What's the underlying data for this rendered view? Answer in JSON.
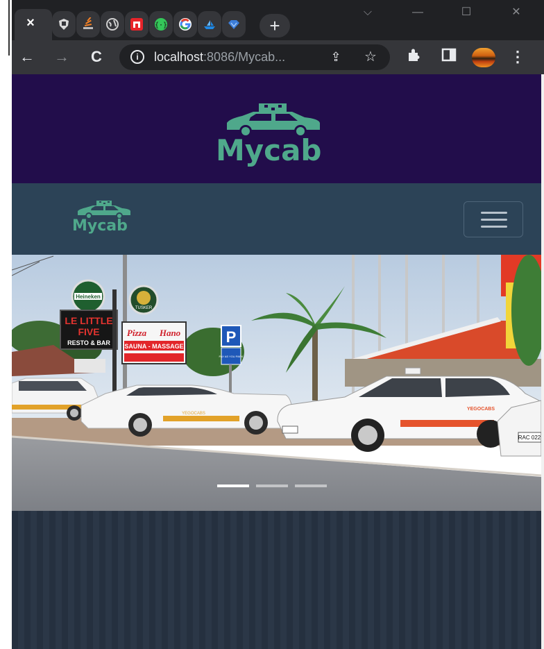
{
  "browser": {
    "active_tab_close": "×",
    "pinned_tabs": [
      {
        "icon": "shield-icon",
        "color": "#d9d9d9"
      },
      {
        "icon": "stack-icon",
        "color": "#f48024"
      },
      {
        "icon": "globe-icon",
        "color": "#cfcfcf"
      },
      {
        "icon": "n-logo-icon",
        "color": "#e8242a"
      },
      {
        "icon": "brackets-icon",
        "color": "#34c759"
      },
      {
        "icon": "google-icon",
        "color": "#4285f4"
      },
      {
        "icon": "boat-icon",
        "color": "#1e88e5"
      },
      {
        "icon": "diamond-icon",
        "color": "#3b7dd8"
      }
    ],
    "new_tab": "+",
    "window_controls": {
      "chevron": "⌵",
      "minimize": "—",
      "maximize": "☐",
      "close": "✕"
    },
    "toolbar": {
      "back": "←",
      "forward": "→",
      "reload": "C"
    },
    "url_host": "localhost",
    "url_rest": ":8086/Mycab...",
    "info_icon": "i",
    "share_icon": "⇪",
    "star_icon": "☆",
    "extensions_icon": "✚",
    "sidepanel_icon": "▢",
    "menu_icon": "⋮"
  },
  "site": {
    "brand_color": "#4fa88b",
    "header_bg": "#220d4b",
    "navbar_bg": "#2c4357",
    "logo_text": "Mycab",
    "navbar_logo_text": "Mycab",
    "carousel": {
      "slide_count": 3,
      "active_index": 0,
      "signs": {
        "heineken": "Heineken",
        "bar_line1": "LE LITTLE",
        "bar_line2": "FIVE",
        "bar_line3": "RESTO & BAR",
        "pizza_line1": "Pizza",
        "pizza_line2": "Hano",
        "pizza_line3": "SAUNA - MASSAGE",
        "parking": "P",
        "parking_sub": "PAY AS YOU PARK",
        "tusker": "TUSKER",
        "taxi_brand": "YEGOCABS",
        "plate": "RAC 022"
      }
    }
  }
}
